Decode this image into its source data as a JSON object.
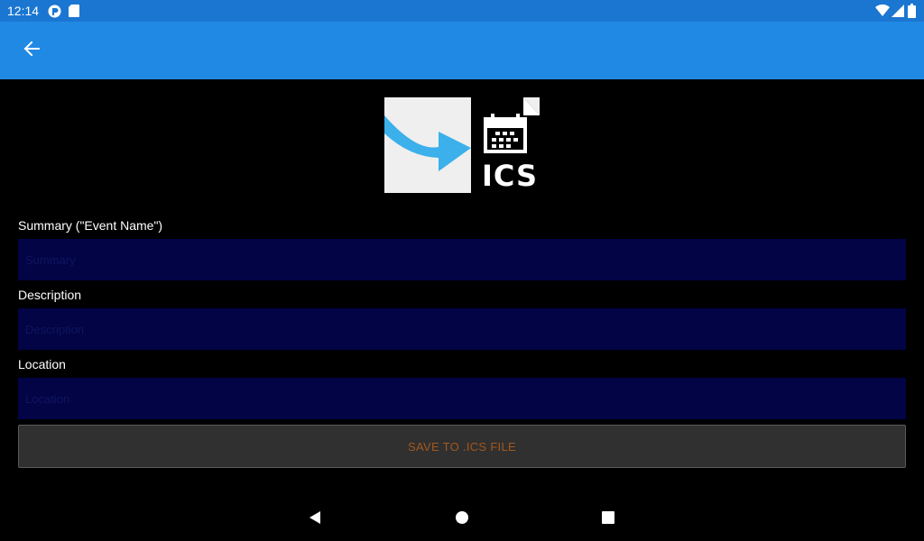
{
  "status_bar": {
    "time": "12:14",
    "icons": [
      "sync-icon",
      "sd-card-icon",
      "wifi-icon",
      "signal-icon",
      "battery-icon"
    ]
  },
  "app_bar": {
    "back_icon": "arrow-back-icon",
    "color": "#2089e4"
  },
  "hero_image": {
    "label": "ICS",
    "icons": [
      "arrow-icon",
      "calendar-file-icon"
    ]
  },
  "form": {
    "summary": {
      "label": "Summary (\"Event Name\")",
      "placeholder": "Summary",
      "value": ""
    },
    "description": {
      "label": "Description",
      "placeholder": "Description",
      "value": ""
    },
    "location": {
      "label": "Location",
      "placeholder": "Location",
      "value": ""
    },
    "save_label": "SAVE TO .ICS FILE"
  },
  "nav_bar": {
    "icons": [
      "back-triangle-icon",
      "home-circle-icon",
      "recents-square-icon"
    ]
  }
}
